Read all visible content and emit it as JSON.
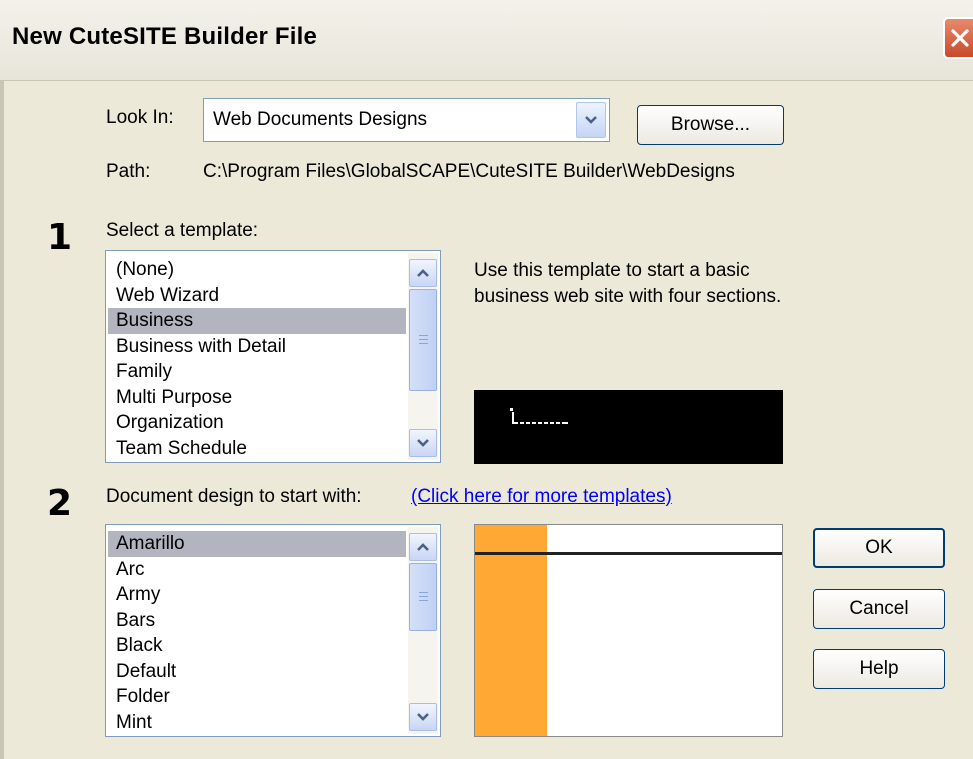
{
  "window": {
    "title": "New CuteSITE Builder File",
    "close_icon": "close-x-icon"
  },
  "look_in": {
    "label": "Look In:",
    "value": "Web Documents Designs",
    "browse_label": "Browse..."
  },
  "path": {
    "label": "Path:",
    "value": "C:\\Program Files\\GlobalSCAPE\\CuteSITE Builder\\WebDesigns"
  },
  "step1": {
    "number": "1",
    "label": "Select a template:",
    "description": "Use this template to start a basic business web site with four sections.",
    "templates": [
      "(None)",
      "Web Wizard",
      "Business",
      "Business with Detail",
      "Family",
      "Multi Purpose",
      "Organization",
      "Team Schedule"
    ],
    "selected": "Business"
  },
  "step2": {
    "number": "2",
    "label": "Document design to start with:",
    "more_link": "(Click here for more templates)",
    "designs": [
      "Amarillo",
      "Arc",
      "Army",
      "Bars",
      "Black",
      "Default",
      "Folder",
      "Mint"
    ],
    "selected": "Amarillo"
  },
  "buttons": {
    "ok": "OK",
    "cancel": "Cancel",
    "help": "Help"
  },
  "colors": {
    "dialog_bg": "#ece9d8",
    "selection": "#b2b4bf",
    "link": "#0000ff",
    "design_accent": "#ffa833"
  }
}
